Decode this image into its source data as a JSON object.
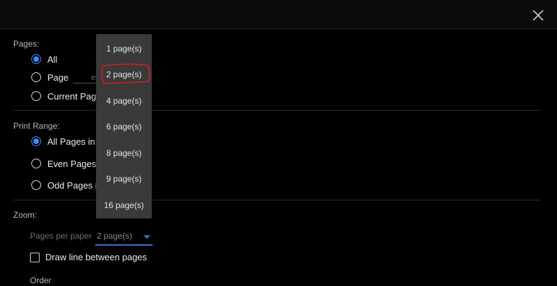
{
  "icons": {
    "close": "close-icon",
    "dropdown_caret": "chevron-down-icon"
  },
  "colors": {
    "accent": "#3d8bff",
    "background": "#000000",
    "menu": "#3a3a3a",
    "highlight_mark": "#d01f1f"
  },
  "pages": {
    "label": "Pages:",
    "options": {
      "all": "All",
      "page": "Page",
      "current": "Current Pag"
    },
    "page_input_placeholder": "e"
  },
  "print_range": {
    "label": "Print Range:",
    "options": {
      "all": "All Pages in",
      "even": "Even Pages i",
      "odd": "Odd Pages i"
    }
  },
  "zoom": {
    "label": "Zoom:",
    "pages_per_paper_label": "Pages per paper",
    "pages_per_paper_value": "2 page(s)",
    "draw_line_label": "Draw line between pages",
    "order_label": "Order"
  },
  "dropdown": {
    "items": [
      "1 page(s)",
      "2 page(s)",
      "4 page(s)",
      "6 page(s)",
      "8 page(s)",
      "9 page(s)",
      "16 page(s)"
    ],
    "marked_item": "2 page(s)"
  }
}
